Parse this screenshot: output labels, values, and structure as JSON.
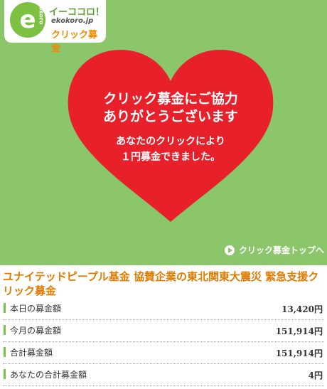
{
  "logo": {
    "mark": "e",
    "mark_small": "kokoro",
    "name": "イーココロ！",
    "url": "ekokoro.jp",
    "subtitle": "クリック募金"
  },
  "heart": {
    "line1": "クリック募金にご協力",
    "line2": "ありがとうございます",
    "line3": "あなたのクリックにより",
    "line4": "１円募金できました。",
    "color": "#e8202a"
  },
  "top_link": {
    "label": "クリック募金トップへ"
  },
  "campaign": {
    "title": "ユナイテッドピープル基金 協賛企業の東北関東大震災 緊急支援クリック募金"
  },
  "stats": [
    {
      "label": "本日の募金額",
      "value": "13,420",
      "unit": "円"
    },
    {
      "label": "今月の募金額",
      "value": "151,914",
      "unit": "円"
    },
    {
      "label": "合計募金額",
      "value": "151,914",
      "unit": "円"
    },
    {
      "label": "あなたの合計募金額",
      "value": "4",
      "unit": "円"
    }
  ],
  "colors": {
    "background_green": "#8cc66a",
    "accent_orange": "#e07b00",
    "bar_green": "#7cc142"
  }
}
